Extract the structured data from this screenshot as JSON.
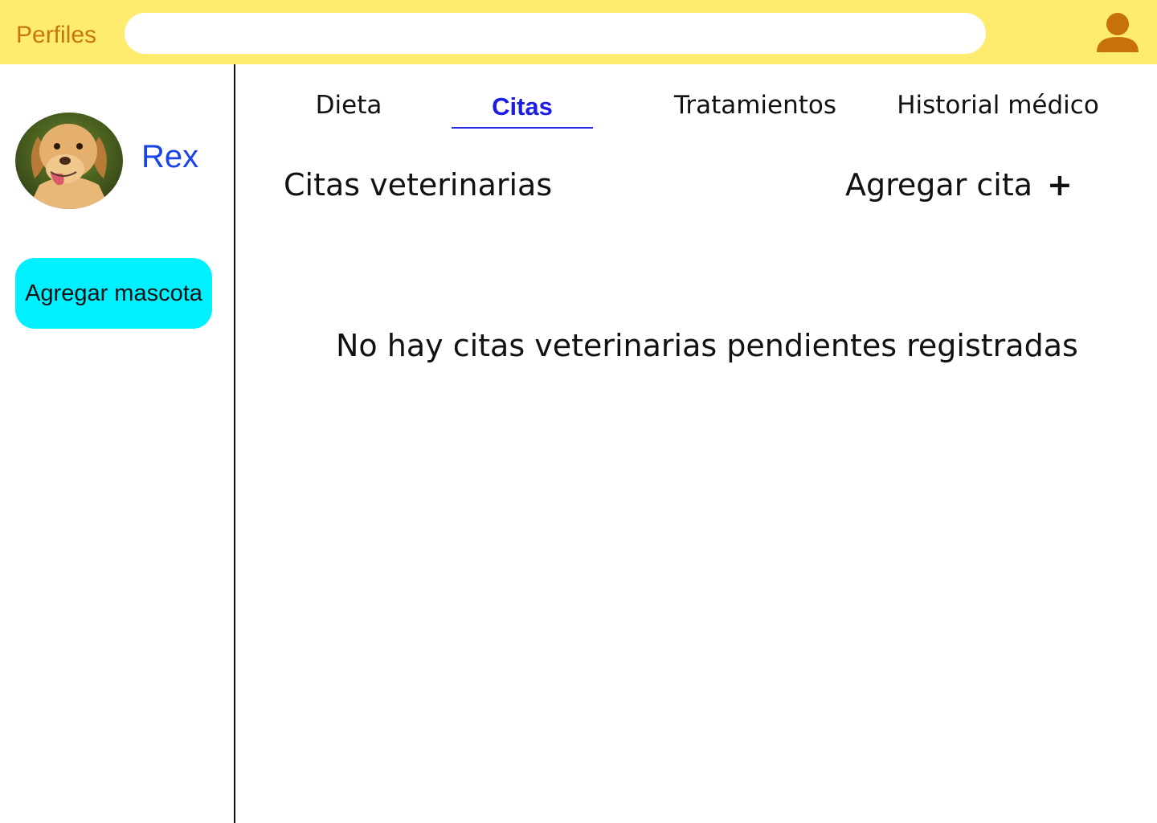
{
  "header": {
    "brand": "Perfiles",
    "search_value": "",
    "accent_color": "#ffec6e",
    "user_icon": "user-icon"
  },
  "sidebar": {
    "pet": {
      "name": "Rex",
      "avatar": "dog-photo"
    },
    "add_pet_label": "Agregar mascota"
  },
  "tabs": [
    {
      "label": "Dieta",
      "active": false
    },
    {
      "label": "Citas",
      "active": true
    },
    {
      "label": "Tratamientos",
      "active": false
    },
    {
      "label": "Historial médico",
      "active": false
    }
  ],
  "main": {
    "title": "Citas veterinarias",
    "add_label": "Agregar cita",
    "add_icon": "+",
    "empty_message": "No hay citas veterinarias pendientes registradas"
  }
}
